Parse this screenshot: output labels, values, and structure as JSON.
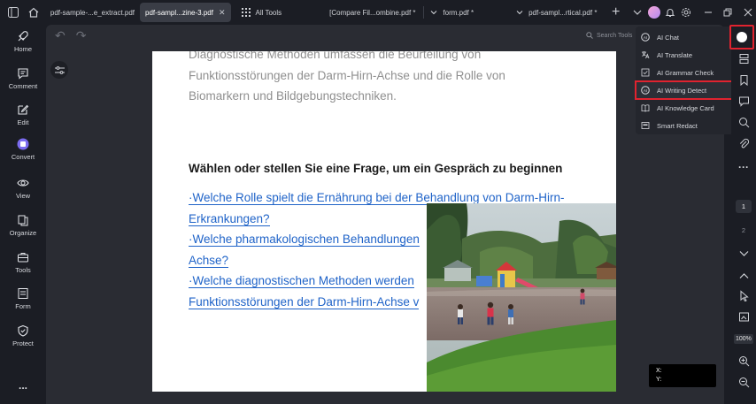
{
  "tabs": [
    {
      "label": "pdf-sample-...e_extract.pdf",
      "active": false
    },
    {
      "label": "pdf-sampl...zine-3.pdf",
      "active": true
    },
    {
      "label": "All Tools",
      "active": false
    },
    {
      "label": "[Compare  Fil...ombine.pdf *",
      "active": false
    },
    {
      "label": "form.pdf *",
      "active": false
    },
    {
      "label": "pdf-sampl...rtical.pdf *",
      "active": false
    }
  ],
  "sidebar": {
    "items": [
      {
        "label": "Home",
        "icon": "rocket-icon"
      },
      {
        "label": "Comment",
        "icon": "comment-icon"
      },
      {
        "label": "Edit",
        "icon": "edit-icon"
      },
      {
        "label": "Convert",
        "icon": "convert-icon"
      },
      {
        "label": "View",
        "icon": "eye-icon"
      },
      {
        "label": "Organize",
        "icon": "organize-icon"
      },
      {
        "label": "Tools",
        "icon": "toolbox-icon"
      },
      {
        "label": "Form",
        "icon": "form-icon"
      },
      {
        "label": "Protect",
        "icon": "shield-icon"
      }
    ],
    "more": "..."
  },
  "toolbar": {
    "search_tools": "Search Tools"
  },
  "document": {
    "para_lines": [
      "Diagnostische Methoden umfassen die Beurteilung von",
      "Funktionsstörungen der Darm-Hirn-Achse und die Rolle von",
      "Biomarkern und Bildgebungstechniken."
    ],
    "heading": "Wählen oder stellen Sie eine Frage, um ein Gespräch zu beginnen",
    "links": [
      "·Welche Rolle spielt die Ernährung bei der Behandlung von Darm-Hirn-",
      "Erkrankungen?",
      "·Welche pharmakologischen Behandlungen",
      "Achse?",
      "·Welche diagnostischen Methoden werden",
      "Funktionsstörungen der Darm-Hirn-Achse v"
    ]
  },
  "ai_menu": {
    "items": [
      {
        "label": "AI Chat",
        "icon": "ai-chat-icon"
      },
      {
        "label": "AI Translate",
        "icon": "translate-icon"
      },
      {
        "label": "AI Grammar Check",
        "icon": "grammar-check-icon"
      },
      {
        "label": "AI Writing Detect",
        "icon": "writing-detect-icon"
      },
      {
        "label": "AI Knowledge Card",
        "icon": "knowledge-card-icon"
      },
      {
        "label": "Smart Redact",
        "icon": "redact-icon"
      }
    ],
    "highlighted": "AI Writing Detect"
  },
  "pagination": {
    "current": "1",
    "next": "2"
  },
  "zoom": "100%",
  "coords": {
    "x_label": "X:",
    "y_label": "Y:"
  },
  "colors": {
    "accent_red": "#e0232f",
    "link_blue": "#1f63c8",
    "background": "#1b1d24"
  }
}
